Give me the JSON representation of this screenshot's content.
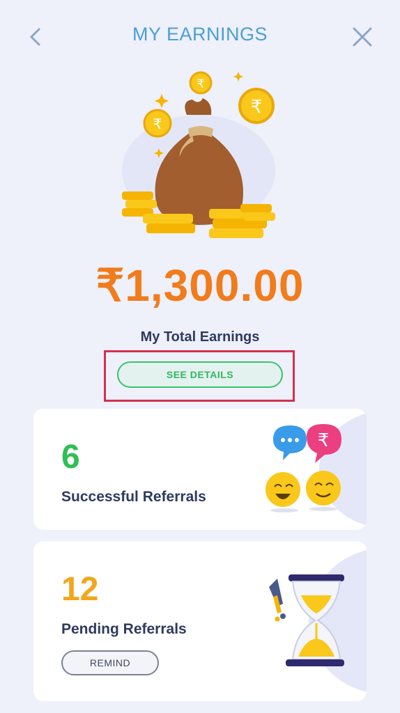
{
  "header": {
    "title": "MY EARNINGS",
    "back_icon": "chevron-left-icon",
    "close_icon": "close-icon"
  },
  "hero": {
    "illustration": "money-bag-with-coins",
    "coin_symbol": "₹"
  },
  "earnings": {
    "amount": "₹1,300.00",
    "label": "My Total Earnings",
    "see_details_label": "SEE DETAILS"
  },
  "stats": {
    "successful": {
      "count": "6",
      "label": "Successful Referrals",
      "icon": "chat-emoji-icon"
    },
    "pending": {
      "count": "12",
      "label": "Pending Referrals",
      "remind_label": "REMIND",
      "icon": "hourglass-icon"
    }
  },
  "colors": {
    "background": "#eef0fa",
    "title": "#4a9fd6",
    "amount": "#f07c1b",
    "success": "#2fbf55",
    "pending": "#f2a71b",
    "highlight": "#d5304c",
    "text": "#2f3a5f"
  }
}
